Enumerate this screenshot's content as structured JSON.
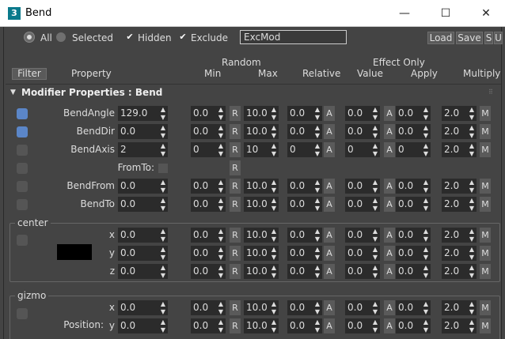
{
  "window": {
    "title": "Bend",
    "app_icon_text": "3",
    "minimize": "—",
    "maximize": "☐",
    "close": "✕"
  },
  "toolbar": {
    "all_label": "All",
    "selected_label": "Selected",
    "hidden_label": "Hidden",
    "exclude_label": "Exclude",
    "exclude_value": "ExcMod",
    "load_label": "Load",
    "save_label": "Save",
    "s_label": "S",
    "u_label": "U"
  },
  "headers": {
    "filter": "Filter",
    "property": "Property",
    "random": "Random",
    "min": "Min",
    "max": "Max",
    "relative": "Relative",
    "effect_only": "Effect Only",
    "value": "Value",
    "apply": "Apply",
    "multiply": "Multiply"
  },
  "section_title": "Modifier Properties : Bend",
  "buttons": {
    "r": "R",
    "a": "A",
    "m": "M"
  },
  "rows": [
    {
      "label": "BendAngle",
      "value": "129.0",
      "min": "0.0",
      "max": "10.0",
      "rel": "0.0",
      "val": "0.0",
      "apply": "0.0",
      "mult": "2.0",
      "selected": true
    },
    {
      "label": "BendDir",
      "value": "0.0",
      "min": "0.0",
      "max": "10.0",
      "rel": "0.0",
      "val": "0.0",
      "apply": "0.0",
      "mult": "2.0",
      "selected": true
    },
    {
      "label": "BendAxis",
      "value": "2",
      "min": "0",
      "max": "10",
      "rel": "0",
      "val": "0",
      "apply": "0",
      "mult": "2.0",
      "selected": false
    },
    {
      "label": "FromTo:"
    },
    {
      "label": "BendFrom",
      "value": "0.0",
      "min": "0.0",
      "max": "10.0",
      "rel": "0.0",
      "val": "0.0",
      "apply": "0.0",
      "mult": "2.0",
      "selected": false
    },
    {
      "label": "BendTo",
      "value": "0.0",
      "min": "0.0",
      "max": "10.0",
      "rel": "0.0",
      "val": "0.0",
      "apply": "0.0",
      "mult": "2.0",
      "selected": false
    }
  ],
  "center": {
    "title": "center",
    "swatch_color": "#000000",
    "rows": [
      {
        "label": "x",
        "value": "0.0",
        "min": "0.0",
        "max": "10.0",
        "rel": "0.0",
        "val": "0.0",
        "apply": "0.0",
        "mult": "2.0"
      },
      {
        "label": "y",
        "value": "0.0",
        "min": "0.0",
        "max": "10.0",
        "rel": "0.0",
        "val": "0.0",
        "apply": "0.0",
        "mult": "2.0"
      },
      {
        "label": "z",
        "value": "0.0",
        "min": "0.0",
        "max": "10.0",
        "rel": "0.0",
        "val": "0.0",
        "apply": "0.0",
        "mult": "2.0"
      }
    ]
  },
  "gizmo": {
    "title": "gizmo",
    "position_label": "Position:",
    "rows": [
      {
        "label": "x",
        "value": "0.0",
        "min": "0.0",
        "max": "10.0",
        "rel": "0.0",
        "val": "0.0",
        "apply": "0.0",
        "mult": "2.0"
      },
      {
        "label": "y",
        "value": "0.0",
        "min": "0.0",
        "max": "10.0",
        "rel": "0.0",
        "val": "0.0",
        "apply": "0.0",
        "mult": "2.0"
      }
    ]
  },
  "colors": {
    "selected_blue": "#5b86c8",
    "panel_bg": "#444444",
    "field_bg": "#2b2b2b"
  }
}
